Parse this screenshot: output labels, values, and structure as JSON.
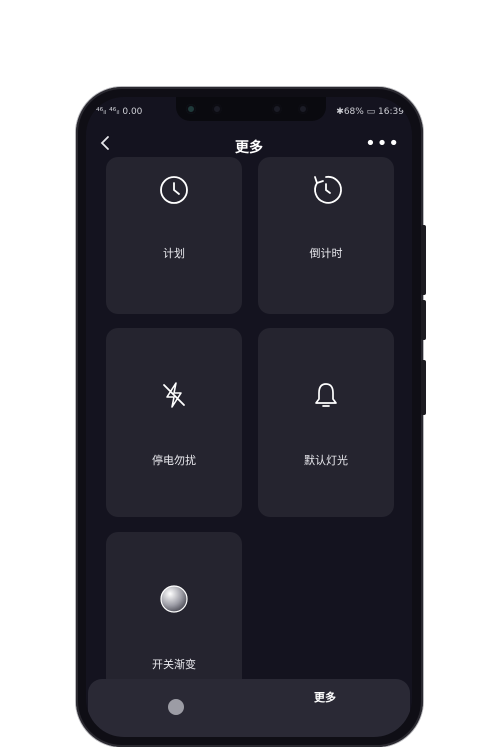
{
  "status": {
    "left": "⁴⁶ᵢₗ ⁴⁶ᵢₗ 0.00",
    "right": "✱68% ▭ 16:39"
  },
  "nav": {
    "back_icon": "chevron-left-icon",
    "title": "更多",
    "more_icon": "ellipsis-icon",
    "more_glyph": "•••"
  },
  "cards": [
    {
      "label": "计划",
      "icon": "clock-icon"
    },
    {
      "label": "倒计时",
      "icon": "countdown-icon"
    },
    {
      "label": "停电勿扰",
      "icon": "no-power-icon"
    },
    {
      "label": "默认灯光",
      "icon": "bell-icon"
    },
    {
      "label": "开关渐变",
      "icon": "gradient-circle-icon"
    }
  ],
  "sheet": {
    "label": "更多"
  },
  "colors": {
    "background": "#14131f",
    "card": "#25242f",
    "text": "#e9e9ee"
  }
}
